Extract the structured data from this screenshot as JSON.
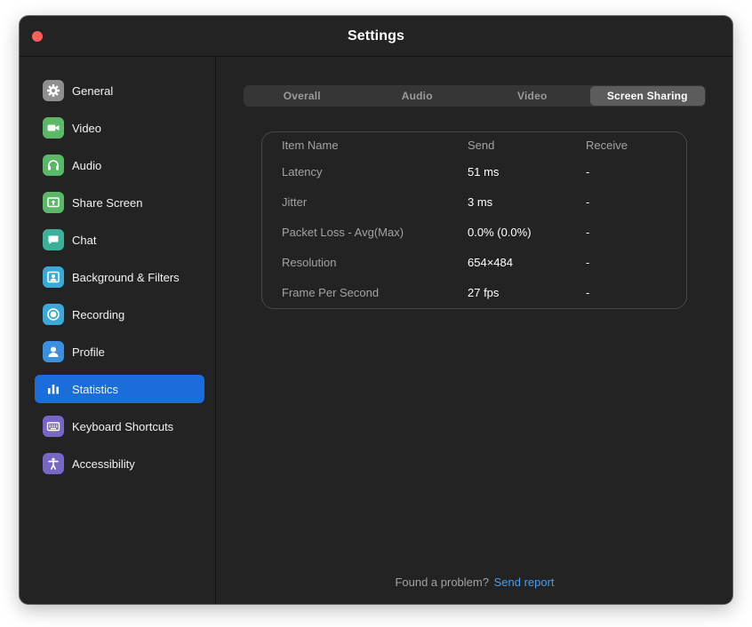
{
  "window": {
    "title": "Settings"
  },
  "sidebar": {
    "items": [
      {
        "label": "General",
        "icon": "gear-icon",
        "color": "#9a9a9a"
      },
      {
        "label": "Video",
        "icon": "video-camera-icon",
        "color": "#58b86a"
      },
      {
        "label": "Audio",
        "icon": "headphones-icon",
        "color": "#58b86a"
      },
      {
        "label": "Share Screen",
        "icon": "share-screen-icon",
        "color": "#58b86a"
      },
      {
        "label": "Chat",
        "icon": "chat-bubble-icon",
        "color": "#3fb39c"
      },
      {
        "label": "Background & Filters",
        "icon": "portrait-icon",
        "color": "#3aa8d8"
      },
      {
        "label": "Recording",
        "icon": "record-icon",
        "color": "#3aa8d8"
      },
      {
        "label": "Profile",
        "icon": "person-icon",
        "color": "#3b8fe0"
      },
      {
        "label": "Statistics",
        "icon": "bar-chart-icon",
        "color": "#1c6ddc"
      },
      {
        "label": "Keyboard Shortcuts",
        "icon": "keyboard-icon",
        "color": "#7a68c9"
      },
      {
        "label": "Accessibility",
        "icon": "accessibility-icon",
        "color": "#7a68c9"
      }
    ],
    "active": "Statistics"
  },
  "tabs": {
    "items": [
      "Overall",
      "Audio",
      "Video",
      "Screen Sharing"
    ],
    "active": "Screen Sharing"
  },
  "stats": {
    "headers": [
      "Item Name",
      "Send",
      "Receive"
    ],
    "rows": [
      [
        "Latency",
        "51 ms",
        "-"
      ],
      [
        "Jitter",
        "3 ms",
        "-"
      ],
      [
        "Packet Loss - Avg(Max)",
        "0.0% (0.0%)",
        "-"
      ],
      [
        "Resolution",
        "654×484",
        "-"
      ],
      [
        "Frame Per Second",
        "27 fps",
        "-"
      ]
    ]
  },
  "footer": {
    "text": "Found a problem?",
    "link": "Send report"
  },
  "colors": {
    "accent": "#1c6ddc",
    "link": "#4a9df0",
    "close": "#fe5f57"
  }
}
